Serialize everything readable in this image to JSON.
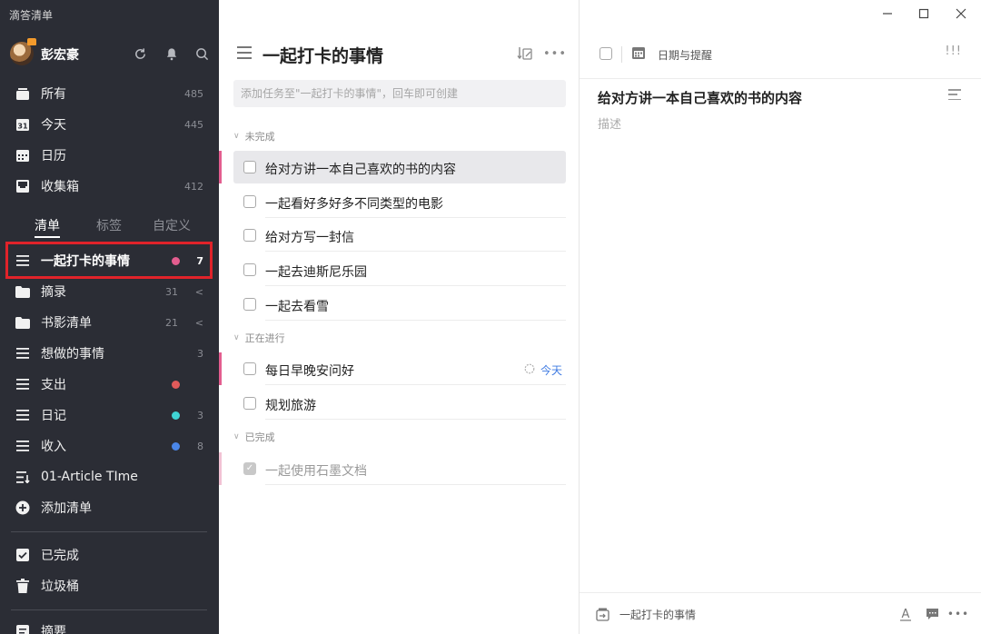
{
  "app": {
    "title": "滴答清单"
  },
  "user": {
    "name": "彭宏豪"
  },
  "sidebar": {
    "smart_lists": [
      {
        "label": "所有",
        "count": "485",
        "icon": "inbox-tray-icon"
      },
      {
        "label": "今天",
        "count": "445",
        "icon": "calendar-day-icon"
      },
      {
        "label": "日历",
        "count": "",
        "icon": "calendar-icon"
      },
      {
        "label": "收集箱",
        "count": "412",
        "icon": "inbox-icon"
      }
    ],
    "tabs": [
      "清单",
      "标签",
      "自定义"
    ],
    "lists": [
      {
        "label": "一起打卡的事情",
        "count": "7",
        "dot": "#e35d8f",
        "icon": "list-icon"
      },
      {
        "label": "摘录",
        "count": "31",
        "chevron": "<",
        "icon": "folder-icon"
      },
      {
        "label": "书影清单",
        "count": "21",
        "chevron": "<",
        "icon": "folder-icon"
      },
      {
        "label": "想做的事情",
        "count": "3",
        "icon": "list-icon"
      },
      {
        "label": "支出",
        "count": "",
        "dot": "#e05a5a",
        "icon": "list-icon"
      },
      {
        "label": "日记",
        "count": "3",
        "dot": "#3fd3d3",
        "icon": "list-icon"
      },
      {
        "label": "收入",
        "count": "8",
        "dot": "#4a86e8",
        "icon": "list-icon"
      },
      {
        "label": "01-Article TIme",
        "count": "",
        "icon": "list-sort-icon"
      },
      {
        "label": "添加清单",
        "count": "",
        "icon": "add-circle-icon"
      }
    ],
    "bottom": [
      {
        "label": "已完成",
        "icon": "checkbox-checked-icon"
      },
      {
        "label": "垃圾桶",
        "icon": "trash-icon"
      },
      {
        "label": "摘要",
        "icon": "summary-icon"
      }
    ]
  },
  "list_view": {
    "title": "一起打卡的事情",
    "add_placeholder": "添加任务至\"一起打卡的事情\"，回车即可创建",
    "sections": [
      {
        "name": "未完成",
        "tasks": [
          {
            "title": "给对方讲一本自己喜欢的书的内容",
            "selected": true
          },
          {
            "title": "一起看好多好多不同类型的电影"
          },
          {
            "title": "给对方写一封信"
          },
          {
            "title": "一起去迪斯尼乐园"
          },
          {
            "title": "一起去看雪"
          }
        ]
      },
      {
        "name": "正在进行",
        "tasks": [
          {
            "title": "每日早晚安问好",
            "due": "今天"
          },
          {
            "title": "规划旅游"
          }
        ]
      },
      {
        "name": "已完成",
        "tasks": [
          {
            "title": "一起使用石墨文档",
            "done": true
          }
        ]
      }
    ]
  },
  "detail": {
    "date_label": "日期与提醒",
    "priority": "!!!",
    "title": "给对方讲一本自己喜欢的书的内容",
    "description_placeholder": "描述",
    "footer_list": "一起打卡的事情"
  },
  "colors": {
    "sidebar_bg": "#2b2d35",
    "accent_pink": "#e35d8f",
    "highlight_red": "#e0232a",
    "due_blue": "#3e7ae2"
  }
}
